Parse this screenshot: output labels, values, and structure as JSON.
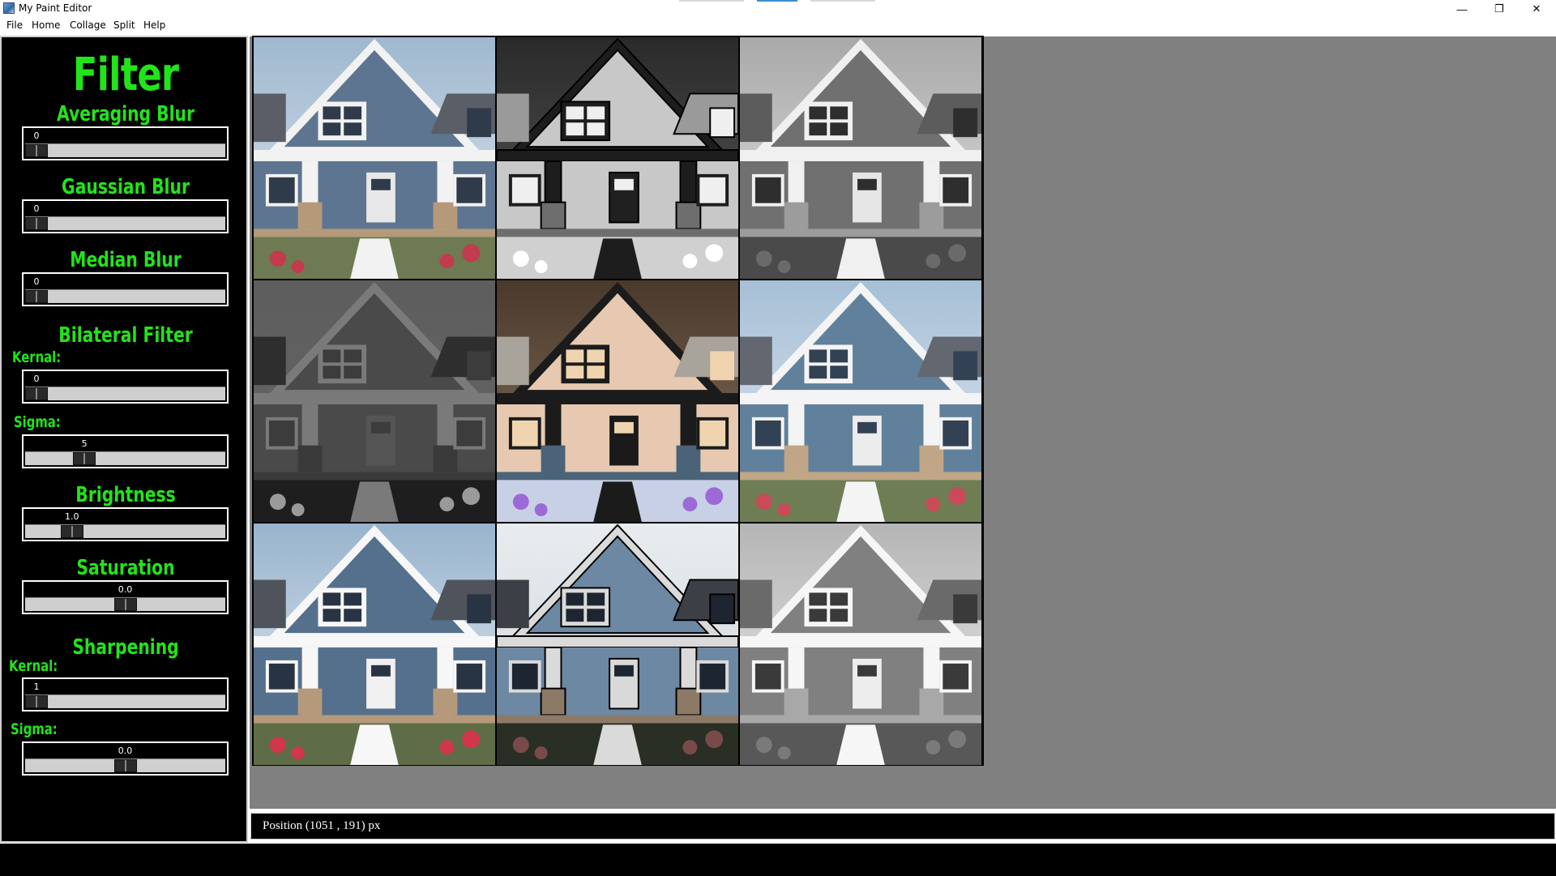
{
  "window": {
    "title": "My Paint Editor",
    "controls": [
      "—",
      "❐",
      "✕"
    ]
  },
  "menu": {
    "items": [
      "File",
      "Home",
      "Collage",
      "Split",
      "Help"
    ]
  },
  "panel": {
    "title": "Filter",
    "accent_color": "#22e41a",
    "sections": {
      "averaging_blur": {
        "title": "Averaging Blur",
        "value": "0",
        "level": 0.0
      },
      "gaussian_blur": {
        "title": "Gaussian Blur",
        "value": "0",
        "level": 0.0
      },
      "median_blur": {
        "title": "Median Blur",
        "value": "0",
        "level": 0.0
      },
      "bilateral": {
        "title": "Bilateral Filter",
        "kernel_label": "Kernal:",
        "kernel_value": "0",
        "kernel_level": 0.0,
        "sigma_label": "Sigma:",
        "sigma_value": "5",
        "sigma_level": 0.27
      },
      "brightness": {
        "title": "Brightness",
        "value": "1.0",
        "level": 0.2
      },
      "saturation": {
        "title": "Saturation",
        "value": "0.0",
        "level": 0.5
      },
      "sharpening": {
        "title": "Sharpening",
        "kernel_label": "Kernal:",
        "kernel_value": "1",
        "kernel_level": 0.0,
        "sigma_label": "Sigma:",
        "sigma_value": "0.0",
        "sigma_level": 0.5
      }
    }
  },
  "collage": {
    "tiles": [
      "original-color",
      "edge-negative-gray",
      "grayscale",
      "quantized-gray",
      "color-negative",
      "blurred-color",
      "sharpened-color",
      "cartoon-edges",
      "grayscale-light"
    ]
  },
  "status": {
    "text": "Position (1051 , 191) px"
  }
}
